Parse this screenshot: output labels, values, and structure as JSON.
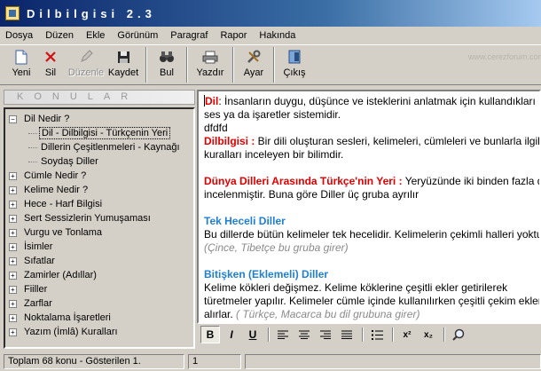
{
  "window": {
    "title": "Dilbilgisi 2.3"
  },
  "menu": [
    {
      "label": "Dosya"
    },
    {
      "label": "Düzen"
    },
    {
      "label": "Ekle"
    },
    {
      "label": "Görünüm"
    },
    {
      "label": "Paragraf"
    },
    {
      "label": "Rapor"
    },
    {
      "label": "Hakında"
    }
  ],
  "toolbar": {
    "new_label": "Yeni",
    "delete_label": "Sil",
    "edit_label": "Düzenle",
    "save_label": "Kaydet",
    "find_label": "Bul",
    "print_label": "Yazdır",
    "settings_label": "Ayar",
    "exit_label": "Çıkış",
    "watermark": "www.cerezforum.com"
  },
  "sidebar": {
    "header": "KONULAR",
    "items": [
      {
        "label": "Dil Nedir ?",
        "expanded": true
      },
      {
        "label": "Dil - Dilbilgisi - Türkçenin Yeri",
        "child": true
      },
      {
        "label": "Dillerin Çeşitlenmeleri - Kaynağı",
        "child": true
      },
      {
        "label": "Soydaş Diller",
        "child": true
      },
      {
        "label": "Cümle Nedir ?"
      },
      {
        "label": "Kelime Nedir ?"
      },
      {
        "label": "Hece - Harf Bilgisi"
      },
      {
        "label": "Sert Sessizlerin Yumuşaması"
      },
      {
        "label": "Vurgu ve Tonlama"
      },
      {
        "label": "İsimler"
      },
      {
        "label": "Sıfatlar"
      },
      {
        "label": "Zamirler (Adıllar)"
      },
      {
        "label": "Fiiller"
      },
      {
        "label": "Zarflar"
      },
      {
        "label": "Noktalama İşaretleri"
      },
      {
        "label": "Yazım (İmlâ) Kuralları"
      }
    ]
  },
  "editor": {
    "p1_term": "Dil",
    "p1_text": ": İnsanların duygu, düşünce ve isteklerini anlatmak için kullandıkları",
    "p1_line2": "ses ya da işaretler sistemidir.",
    "p1_line3": "dfdfd",
    "p2_term": "Dilbilgisi :",
    "p2_text": " Bir dili oluşturan sesleri, kelimeleri, cümleleri ve bunlarla ilgili",
    "p2_line2": "kuralları inceleyen bir bilimdir.",
    "p3_term": "Dünya Dilleri Arasında Türkçe'nin Yeri :",
    "p3_text": " Yeryüzünde iki binden fazla dil",
    "p3_line2": "incelenmiştir. Buna göre Diller üç gruba ayrılır",
    "h1": "Tek Heceli Diller",
    "h1_text": "Bu dillerde bütün kelimeler tek hecelidir. Kelimelerin çekimli halleri yoktur.",
    "h1_example": "(Çince, Tibetçe bu gruba girer)",
    "h2": "Bitişken (Eklemeli) Diller",
    "h2_line1": "Kelime kökleri değişmez. Kelime köklerine çeşitli ekler getirilerek",
    "h2_line2": "türetmeler yapılır. Kelimeler cümle içinde kullanılırken çeşitli çekim ekleri",
    "h2_line3": "alırlar.",
    "h2_example": " ( Türkçe, Macarca bu dil grubuna girer)"
  },
  "format_bar": {
    "bold": "B",
    "italic": "I",
    "underline": "U",
    "superscript": "x²",
    "subscript": "x₂"
  },
  "status": {
    "topics": "Toplam 68 konu - Gösterilen  1.",
    "line": "1"
  }
}
